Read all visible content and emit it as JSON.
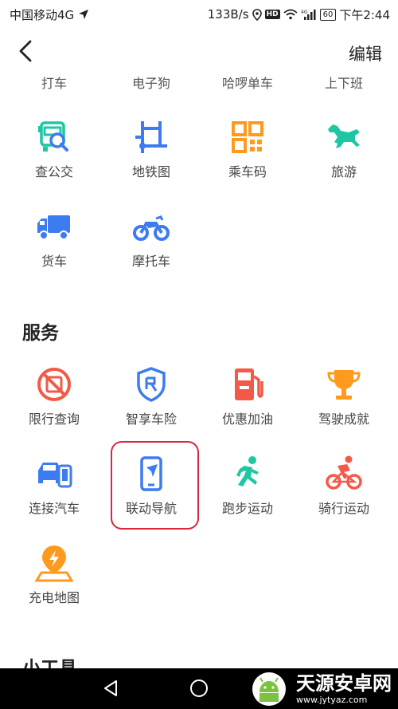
{
  "status_bar": {
    "carrier": "中国移动4G",
    "speed": "133B/s",
    "hd": "HD",
    "battery": "60",
    "time": "下午2:44"
  },
  "header": {
    "edit_label": "编辑"
  },
  "top_row": [
    "打车",
    "电子狗",
    "哈啰单车",
    "上下班"
  ],
  "transport": [
    {
      "label": "查公交",
      "icon": "bus-search-icon"
    },
    {
      "label": "地铁图",
      "icon": "subway-map-icon"
    },
    {
      "label": "乘车码",
      "icon": "qr-code-icon"
    },
    {
      "label": "旅游",
      "icon": "horse-icon"
    },
    {
      "label": "货车",
      "icon": "truck-icon"
    },
    {
      "label": "摩托车",
      "icon": "motorcycle-icon"
    }
  ],
  "services": {
    "title": "服务",
    "items": [
      {
        "label": "限行查询",
        "icon": "restriction-icon"
      },
      {
        "label": "智享车险",
        "icon": "insurance-shield-icon"
      },
      {
        "label": "优惠加油",
        "icon": "fuel-pump-icon"
      },
      {
        "label": "驾驶成就",
        "icon": "trophy-icon"
      },
      {
        "label": "连接汽车",
        "icon": "car-connect-icon"
      },
      {
        "label": "联动导航",
        "icon": "phone-nav-icon"
      },
      {
        "label": "跑步运动",
        "icon": "running-icon"
      },
      {
        "label": "骑行运动",
        "icon": "cycling-icon"
      },
      {
        "label": "充电地图",
        "icon": "charging-map-icon"
      }
    ]
  },
  "tools": {
    "title": "小工具"
  },
  "watermark": {
    "title": "天源安卓网",
    "url": "www.jytyaz.com"
  },
  "colors": {
    "blue": "#3d7bf0",
    "red": "#f25a47",
    "orange": "#ff9a1f",
    "green": "#1fc6a4",
    "highlight": "#d7263d"
  }
}
